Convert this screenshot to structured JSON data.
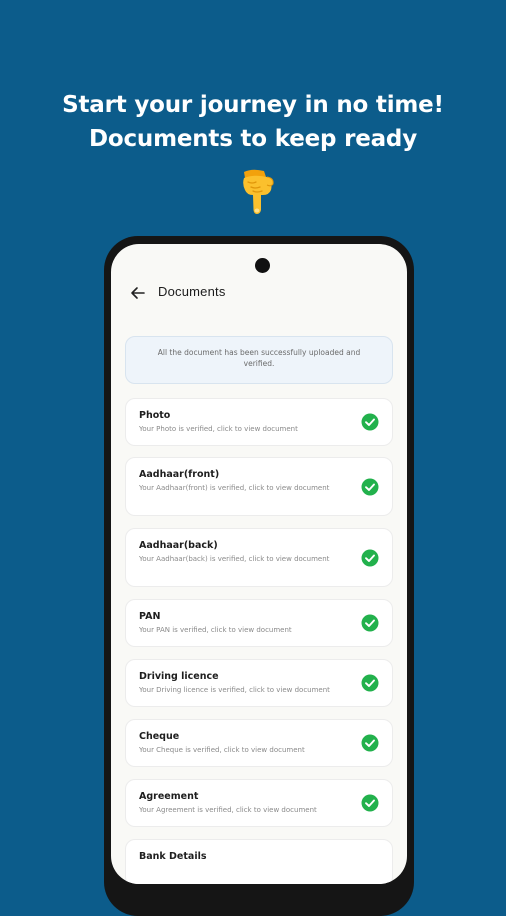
{
  "promo": {
    "headline_line1": "Start your journey in no time!",
    "headline_line2": "Documents to keep ready",
    "hand_icon": "pointing-down-hand-icon"
  },
  "header": {
    "back_icon": "arrow-left-icon",
    "title": "Documents"
  },
  "notice": {
    "text": "All the document has been successfully uploaded and verified."
  },
  "documents": [
    {
      "title": "Photo",
      "subtitle": "Your Photo is verified, click to view document",
      "status": "verified"
    },
    {
      "title": "Aadhaar(front)",
      "subtitle": "Your Aadhaar(front) is verified, click to view document",
      "status": "verified"
    },
    {
      "title": "Aadhaar(back)",
      "subtitle": "Your Aadhaar(back) is verified, click to view document",
      "status": "verified"
    },
    {
      "title": "PAN",
      "subtitle": "Your PAN is verified, click to view document",
      "status": "verified"
    },
    {
      "title": "Driving licence",
      "subtitle": "Your Driving licence is verified, click to view document",
      "status": "verified"
    },
    {
      "title": "Cheque",
      "subtitle": "Your Cheque is verified, click to view document",
      "status": "verified"
    },
    {
      "title": "Agreement",
      "subtitle": "Your Agreement is verified, click to view document",
      "status": "verified"
    },
    {
      "title": "Bank Details",
      "subtitle": "",
      "status": "verified"
    }
  ],
  "colors": {
    "background": "#0c5c8b",
    "check_green": "#22b14c",
    "notice_bg": "#eef4fa"
  }
}
